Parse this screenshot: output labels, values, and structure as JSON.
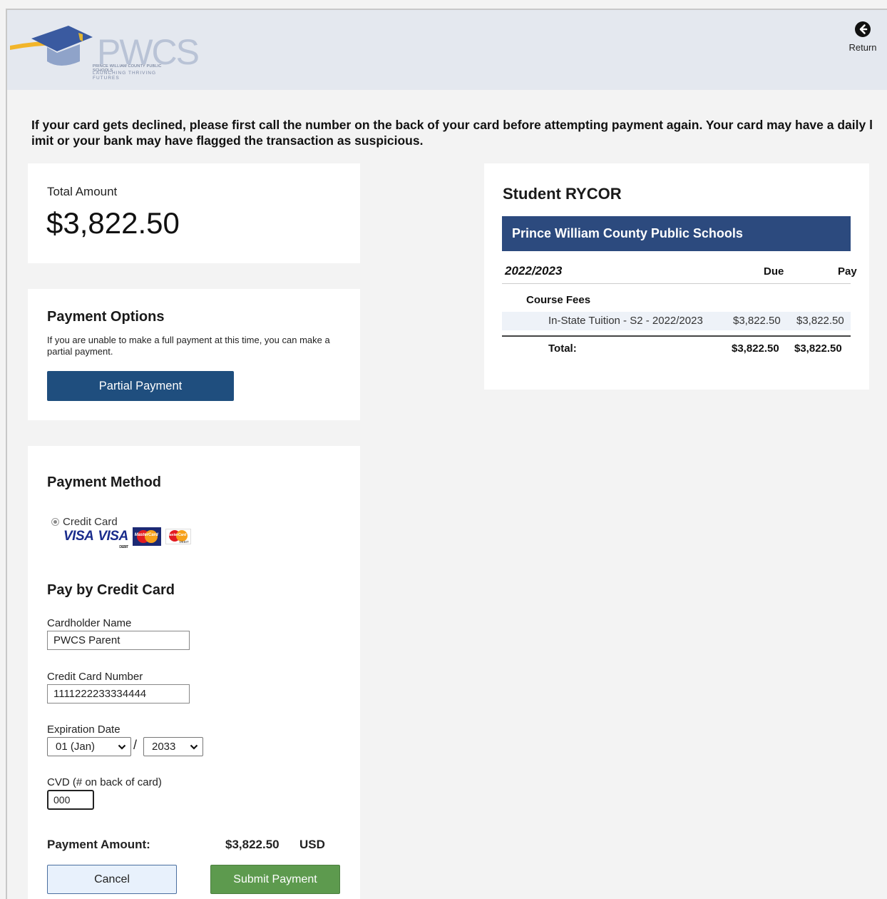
{
  "header": {
    "logo_title": "PWCS",
    "logo_line1": "PRINCE WILLIAM COUNTY PUBLIC SCHOOLS",
    "logo_line2": "LAUNCHING THRIVING FUTURES",
    "return_label": "Return",
    "return_icon": "arrow-left-circle-icon"
  },
  "notice": "If your card gets declined, please first call the number on the back of your card before attempting payment again. Your card may have a daily limit or your bank may have flagged the transaction as suspicious.",
  "total": {
    "label": "Total Amount",
    "value": "$3,822.50"
  },
  "payment_options": {
    "title": "Payment Options",
    "text": "If you are unable to make a full payment at this time, you can make a partial payment.",
    "partial_button": "Partial Payment"
  },
  "payment_method": {
    "title": "Payment Method",
    "radio_label": "Credit Card",
    "card_logos": [
      "VISA",
      "VISA",
      "MasterCard",
      "MasterCard"
    ],
    "visa_debit_tag": "DEBIT",
    "mc_debit_tag": "DEBIT",
    "pay_title": "Pay by Credit Card",
    "cardholder_label": "Cardholder Name",
    "cardholder_value": "PWCS Parent",
    "card_number_label": "Credit Card Number",
    "card_number_value": "1111222233334444",
    "expiration_label": "Expiration Date",
    "exp_month": "01 (Jan)",
    "exp_separator": "/",
    "exp_year": "2033",
    "cvd_label": "CVD (# on back of card)",
    "cvd_value": "000",
    "amount_label": "Payment Amount:",
    "amount_value": "$3,822.50",
    "amount_currency": "USD",
    "cancel_button": "Cancel",
    "submit_button": "Submit Payment"
  },
  "student": {
    "title": "Student RYCOR",
    "school": "Prince William County Public Schools",
    "year": "2022/2023",
    "col_due": "Due",
    "col_pay": "Pay",
    "group_label": "Course Fees",
    "fee_name": "In-State Tuition - S2 - 2022/2023",
    "fee_due": "$3,822.50",
    "fee_pay": "$3,822.50",
    "total_label": "Total:",
    "total_due": "$3,822.50",
    "total_pay": "$3,822.50"
  },
  "colors": {
    "header_bg": "#e4e8ef",
    "primary_button": "#1f4e7e",
    "school_bar": "#2c4a7e",
    "submit_button": "#5d9a4e",
    "cancel_button_bg": "#e8f1fc"
  }
}
